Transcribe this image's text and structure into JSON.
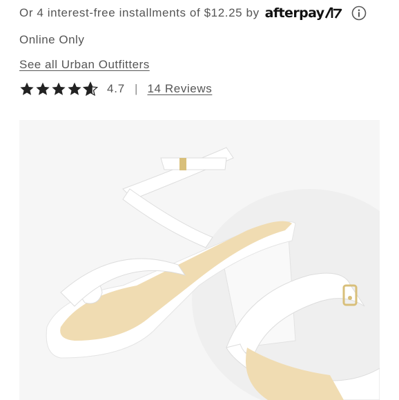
{
  "payment": {
    "installment_text": "Or 4 interest-free installments of $12.25 by",
    "brand": "afterpay",
    "info_icon": "info-icon"
  },
  "availability": "Online Only",
  "see_all_link": "See all Urban Outfitters",
  "rating": {
    "stars": 4.7,
    "max_stars": 5,
    "value_label": "4.7",
    "separator": "|",
    "reviews_label": "14 Reviews"
  },
  "product_image": {
    "subject": "white platform strappy sandals",
    "background_color": "#f6f6f6",
    "strap_color": "#ffffff",
    "insole_color": "#f0dcb2",
    "buckle_color": "#d8bf7a"
  }
}
